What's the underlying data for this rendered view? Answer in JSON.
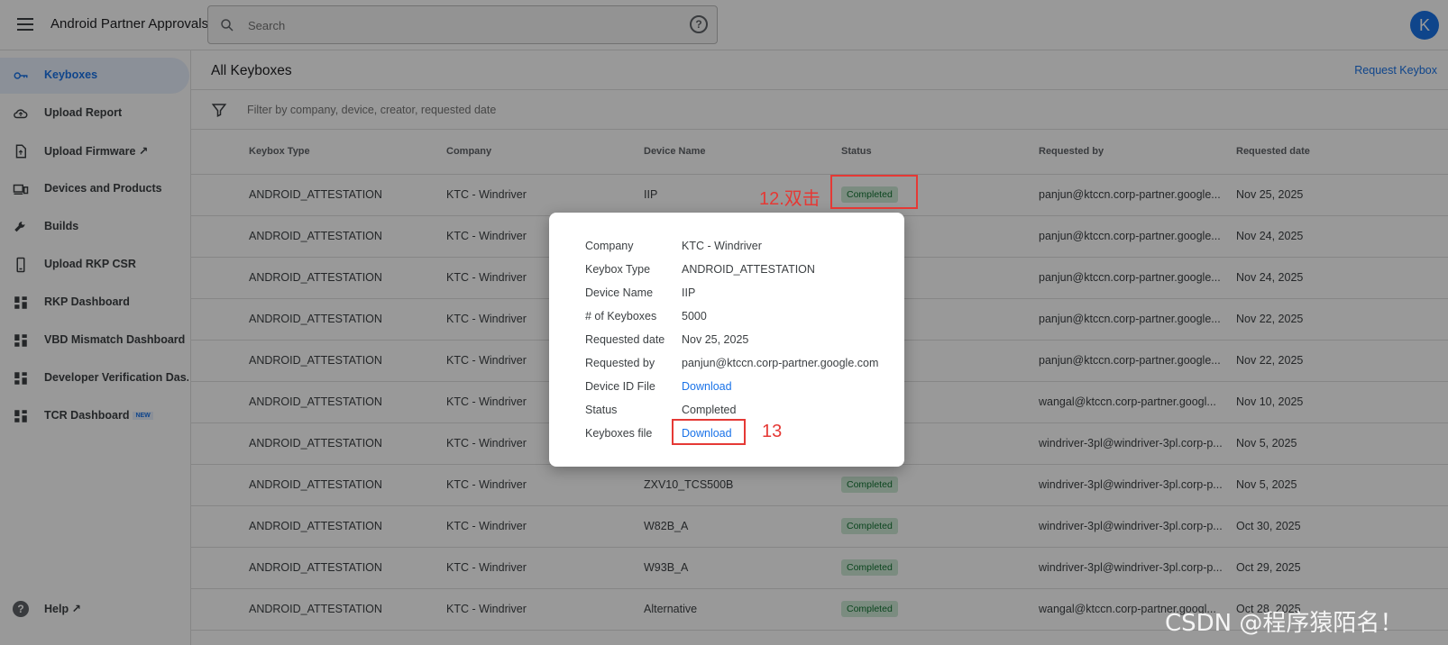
{
  "header": {
    "app_title": "Android Partner Approvals",
    "search_placeholder": "Search",
    "help_icon": "?",
    "avatar_initial": "K"
  },
  "sidebar": {
    "items": [
      {
        "label": "Keyboxes",
        "icon": "key-icon",
        "active": true
      },
      {
        "label": "Upload Report",
        "icon": "cloud-upload-icon"
      },
      {
        "label": "Upload Firmware ↗",
        "icon": "file-upload-icon"
      },
      {
        "label": "Devices and Products",
        "icon": "devices-icon"
      },
      {
        "label": "Builds",
        "icon": "wrench-icon"
      },
      {
        "label": "Upload RKP CSR",
        "icon": "phone-icon"
      },
      {
        "label": "RKP Dashboard",
        "icon": "dashboard-icon"
      },
      {
        "label": "VBD Mismatch Dashboard",
        "icon": "dashboard-icon"
      },
      {
        "label": "Developer Verification Das...",
        "icon": "dashboard-icon"
      },
      {
        "label": "TCR Dashboard",
        "icon": "dashboard-icon",
        "badge": "NEW"
      }
    ],
    "help_label": "Help ↗"
  },
  "main": {
    "title": "All Keyboxes",
    "request_link": "Request Keybox",
    "filter_placeholder": "Filter by company, device, creator, requested date",
    "columns": [
      "Keybox Type",
      "Company",
      "Device Name",
      "Status",
      "Requested by",
      "Requested date"
    ],
    "rows": [
      {
        "type": "ANDROID_ATTESTATION",
        "company": "KTC - Windriver",
        "device": "IIP",
        "status": "Completed",
        "requested_by": "panjun@ktccn.corp-partner.google...",
        "date": "Nov 25, 2025"
      },
      {
        "type": "ANDROID_ATTESTATION",
        "company": "KTC - Windriver",
        "device": "",
        "status": "",
        "requested_by": "panjun@ktccn.corp-partner.google...",
        "date": "Nov 24, 2025"
      },
      {
        "type": "ANDROID_ATTESTATION",
        "company": "KTC - Windriver",
        "device": "",
        "status": "",
        "requested_by": "panjun@ktccn.corp-partner.google...",
        "date": "Nov 24, 2025"
      },
      {
        "type": "ANDROID_ATTESTATION",
        "company": "KTC - Windriver",
        "device": "",
        "status": "",
        "requested_by": "panjun@ktccn.corp-partner.google...",
        "date": "Nov 22, 2025"
      },
      {
        "type": "ANDROID_ATTESTATION",
        "company": "KTC - Windriver",
        "device": "",
        "status": "",
        "requested_by": "panjun@ktccn.corp-partner.google...",
        "date": "Nov 22, 2025"
      },
      {
        "type": "ANDROID_ATTESTATION",
        "company": "KTC - Windriver",
        "device": "",
        "status": "",
        "requested_by": "wangal@ktccn.corp-partner.googl...",
        "date": "Nov 10, 2025"
      },
      {
        "type": "ANDROID_ATTESTATION",
        "company": "KTC - Windriver",
        "device": "",
        "status": "",
        "requested_by": "windriver-3pl@windriver-3pl.corp-p...",
        "date": "Nov 5, 2025"
      },
      {
        "type": "ANDROID_ATTESTATION",
        "company": "KTC - Windriver",
        "device": "ZXV10_TCS500B",
        "status": "Completed",
        "requested_by": "windriver-3pl@windriver-3pl.corp-p...",
        "date": "Nov 5, 2025"
      },
      {
        "type": "ANDROID_ATTESTATION",
        "company": "KTC - Windriver",
        "device": "W82B_A",
        "status": "Completed",
        "requested_by": "windriver-3pl@windriver-3pl.corp-p...",
        "date": "Oct 30, 2025"
      },
      {
        "type": "ANDROID_ATTESTATION",
        "company": "KTC - Windriver",
        "device": "W93B_A",
        "status": "Completed",
        "requested_by": "windriver-3pl@windriver-3pl.corp-p...",
        "date": "Oct 29, 2025"
      },
      {
        "type": "ANDROID_ATTESTATION",
        "company": "KTC - Windriver",
        "device": "Alternative",
        "status": "Completed",
        "requested_by": "wangal@ktccn.corp-partner.googl...",
        "date": "Oct 28, 2025"
      }
    ]
  },
  "dialog": {
    "fields": [
      {
        "key": "Company",
        "value": "KTC - Windriver"
      },
      {
        "key": "Keybox Type",
        "value": "ANDROID_ATTESTATION"
      },
      {
        "key": "Device Name",
        "value": "IIP"
      },
      {
        "key": "# of Keyboxes",
        "value": "5000"
      },
      {
        "key": "Requested date",
        "value": "Nov 25, 2025"
      },
      {
        "key": "Requested by",
        "value": "panjun@ktccn.corp-partner.google.com"
      },
      {
        "key": "Device ID File",
        "value": "Download",
        "link": true
      },
      {
        "key": "Status",
        "value": "Completed"
      },
      {
        "key": "Keyboxes file",
        "value": "Download",
        "link": true
      }
    ]
  },
  "annotations": {
    "step12": "12.双击",
    "step13": "13"
  },
  "watermark": "CSDN @程序猿陌名！",
  "colors": {
    "accent": "#1a73e8",
    "annotation": "#e53935",
    "badge_bg": "#ceead6",
    "badge_text": "#137333"
  }
}
